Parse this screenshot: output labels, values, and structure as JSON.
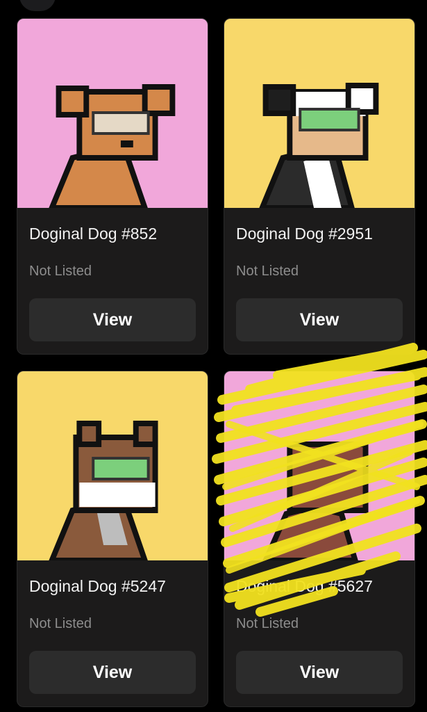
{
  "cards": [
    {
      "title": "Doginal Dog #852",
      "status": "Not Listed",
      "button": "View",
      "bg": "#f1a7da"
    },
    {
      "title": "Doginal Dog #2951",
      "status": "Not Listed",
      "button": "View",
      "bg": "#f8d86a"
    },
    {
      "title": "Doginal Dog #5247",
      "status": "Not Listed",
      "button": "View",
      "bg": "#f8d86a"
    },
    {
      "title": "Doginal Dog #5627",
      "status": "Not Listed",
      "button": "View",
      "bg": "#f1a7da"
    }
  ],
  "colors": {
    "page_bg": "#000000",
    "card_bg": "#1c1b1b",
    "button_bg": "#2c2c2c",
    "status_text": "#8d8d8d",
    "scribble": "#f2e21f"
  }
}
